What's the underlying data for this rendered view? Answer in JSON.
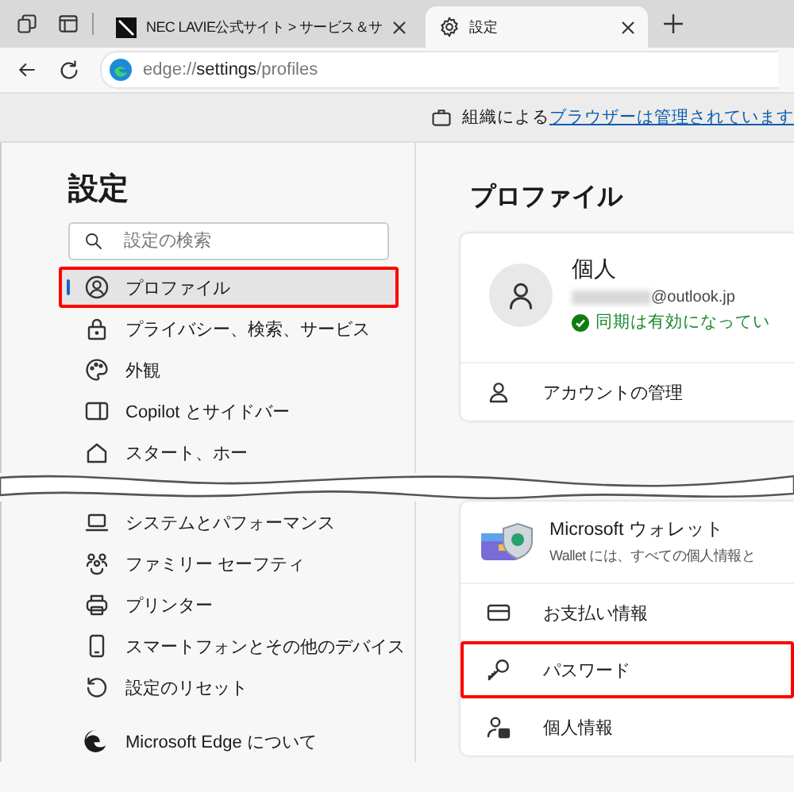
{
  "tabs": [
    {
      "kind": "site",
      "label": "NEC LAVIE公式サイト > サービス＆サ",
      "selected": false
    },
    {
      "kind": "settings",
      "label": "設定",
      "selected": true
    }
  ],
  "address": {
    "value": "edge://**settings**/profiles"
  },
  "managed_notice": {
    "text": "組織による",
    "link": "ブラウザーは管理されています"
  },
  "sidebar": {
    "title": "設定",
    "search": {
      "placeholder": "設定の検索"
    },
    "items": [
      {
        "kind": "profile",
        "label": "プロファイル",
        "selected": true,
        "highlighted": true
      },
      {
        "kind": "lock",
        "label": "プライバシー、検索、サービス",
        "selected": false,
        "highlighted": false
      },
      {
        "kind": "palette",
        "label": "外観",
        "selected": false,
        "highlighted": false
      },
      {
        "kind": "sidebar",
        "label": "Copilot とサイドバー",
        "selected": false,
        "highlighted": false
      },
      {
        "kind": "home",
        "label": "スタート、ホー",
        "selected": false,
        "highlighted": false
      },
      {
        "kind": "laptop",
        "label": "システムとパフォーマンス",
        "selected": false,
        "highlighted": false
      },
      {
        "kind": "family",
        "label": "ファミリー セーフティ",
        "selected": false,
        "highlighted": false
      },
      {
        "kind": "printer",
        "label": "プリンター",
        "selected": false,
        "highlighted": false
      },
      {
        "kind": "phone",
        "label": "スマートフォンとその他のデバイス",
        "selected": false,
        "highlighted": false
      },
      {
        "kind": "reset",
        "label": "設定のリセット",
        "selected": false,
        "highlighted": false
      },
      {
        "kind": "edge",
        "label": "Microsoft Edge について",
        "selected": false,
        "highlighted": false
      }
    ]
  },
  "profile": {
    "title": "プロファイル",
    "account": {
      "name": "個人",
      "email": "@outlook.jp",
      "sync": "同期は有効になってい"
    },
    "links": [
      {
        "kind": "person",
        "label": "アカウントの管理",
        "highlighted": false
      }
    ],
    "wallet": {
      "title": "Microsoft ウォレット",
      "description": "Wallet には、すべての個人情報と"
    },
    "wallet_links": [
      {
        "kind": "card",
        "label": "お支払い情報",
        "highlighted": false
      },
      {
        "kind": "key",
        "label": "パスワード",
        "highlighted": true
      },
      {
        "kind": "id",
        "label": "個人情報",
        "highlighted": false
      }
    ]
  }
}
